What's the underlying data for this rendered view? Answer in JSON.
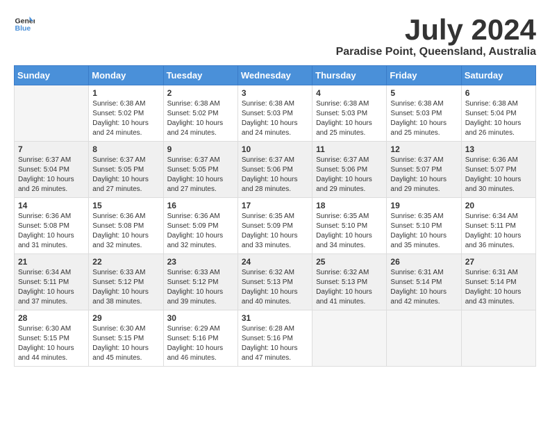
{
  "header": {
    "logo_general": "General",
    "logo_blue": "Blue",
    "month_title": "July 2024",
    "location": "Paradise Point, Queensland, Australia"
  },
  "weekdays": [
    "Sunday",
    "Monday",
    "Tuesday",
    "Wednesday",
    "Thursday",
    "Friday",
    "Saturday"
  ],
  "weeks": [
    [
      {
        "day": "",
        "content": ""
      },
      {
        "day": "1",
        "content": "Sunrise: 6:38 AM\nSunset: 5:02 PM\nDaylight: 10 hours\nand 24 minutes."
      },
      {
        "day": "2",
        "content": "Sunrise: 6:38 AM\nSunset: 5:02 PM\nDaylight: 10 hours\nand 24 minutes."
      },
      {
        "day": "3",
        "content": "Sunrise: 6:38 AM\nSunset: 5:03 PM\nDaylight: 10 hours\nand 24 minutes."
      },
      {
        "day": "4",
        "content": "Sunrise: 6:38 AM\nSunset: 5:03 PM\nDaylight: 10 hours\nand 25 minutes."
      },
      {
        "day": "5",
        "content": "Sunrise: 6:38 AM\nSunset: 5:03 PM\nDaylight: 10 hours\nand 25 minutes."
      },
      {
        "day": "6",
        "content": "Sunrise: 6:38 AM\nSunset: 5:04 PM\nDaylight: 10 hours\nand 26 minutes."
      }
    ],
    [
      {
        "day": "7",
        "content": "Sunrise: 6:37 AM\nSunset: 5:04 PM\nDaylight: 10 hours\nand 26 minutes."
      },
      {
        "day": "8",
        "content": "Sunrise: 6:37 AM\nSunset: 5:05 PM\nDaylight: 10 hours\nand 27 minutes."
      },
      {
        "day": "9",
        "content": "Sunrise: 6:37 AM\nSunset: 5:05 PM\nDaylight: 10 hours\nand 27 minutes."
      },
      {
        "day": "10",
        "content": "Sunrise: 6:37 AM\nSunset: 5:06 PM\nDaylight: 10 hours\nand 28 minutes."
      },
      {
        "day": "11",
        "content": "Sunrise: 6:37 AM\nSunset: 5:06 PM\nDaylight: 10 hours\nand 29 minutes."
      },
      {
        "day": "12",
        "content": "Sunrise: 6:37 AM\nSunset: 5:07 PM\nDaylight: 10 hours\nand 29 minutes."
      },
      {
        "day": "13",
        "content": "Sunrise: 6:36 AM\nSunset: 5:07 PM\nDaylight: 10 hours\nand 30 minutes."
      }
    ],
    [
      {
        "day": "14",
        "content": "Sunrise: 6:36 AM\nSunset: 5:08 PM\nDaylight: 10 hours\nand 31 minutes."
      },
      {
        "day": "15",
        "content": "Sunrise: 6:36 AM\nSunset: 5:08 PM\nDaylight: 10 hours\nand 32 minutes."
      },
      {
        "day": "16",
        "content": "Sunrise: 6:36 AM\nSunset: 5:09 PM\nDaylight: 10 hours\nand 32 minutes."
      },
      {
        "day": "17",
        "content": "Sunrise: 6:35 AM\nSunset: 5:09 PM\nDaylight: 10 hours\nand 33 minutes."
      },
      {
        "day": "18",
        "content": "Sunrise: 6:35 AM\nSunset: 5:10 PM\nDaylight: 10 hours\nand 34 minutes."
      },
      {
        "day": "19",
        "content": "Sunrise: 6:35 AM\nSunset: 5:10 PM\nDaylight: 10 hours\nand 35 minutes."
      },
      {
        "day": "20",
        "content": "Sunrise: 6:34 AM\nSunset: 5:11 PM\nDaylight: 10 hours\nand 36 minutes."
      }
    ],
    [
      {
        "day": "21",
        "content": "Sunrise: 6:34 AM\nSunset: 5:11 PM\nDaylight: 10 hours\nand 37 minutes."
      },
      {
        "day": "22",
        "content": "Sunrise: 6:33 AM\nSunset: 5:12 PM\nDaylight: 10 hours\nand 38 minutes."
      },
      {
        "day": "23",
        "content": "Sunrise: 6:33 AM\nSunset: 5:12 PM\nDaylight: 10 hours\nand 39 minutes."
      },
      {
        "day": "24",
        "content": "Sunrise: 6:32 AM\nSunset: 5:13 PM\nDaylight: 10 hours\nand 40 minutes."
      },
      {
        "day": "25",
        "content": "Sunrise: 6:32 AM\nSunset: 5:13 PM\nDaylight: 10 hours\nand 41 minutes."
      },
      {
        "day": "26",
        "content": "Sunrise: 6:31 AM\nSunset: 5:14 PM\nDaylight: 10 hours\nand 42 minutes."
      },
      {
        "day": "27",
        "content": "Sunrise: 6:31 AM\nSunset: 5:14 PM\nDaylight: 10 hours\nand 43 minutes."
      }
    ],
    [
      {
        "day": "28",
        "content": "Sunrise: 6:30 AM\nSunset: 5:15 PM\nDaylight: 10 hours\nand 44 minutes."
      },
      {
        "day": "29",
        "content": "Sunrise: 6:30 AM\nSunset: 5:15 PM\nDaylight: 10 hours\nand 45 minutes."
      },
      {
        "day": "30",
        "content": "Sunrise: 6:29 AM\nSunset: 5:16 PM\nDaylight: 10 hours\nand 46 minutes."
      },
      {
        "day": "31",
        "content": "Sunrise: 6:28 AM\nSunset: 5:16 PM\nDaylight: 10 hours\nand 47 minutes."
      },
      {
        "day": "",
        "content": ""
      },
      {
        "day": "",
        "content": ""
      },
      {
        "day": "",
        "content": ""
      }
    ]
  ]
}
